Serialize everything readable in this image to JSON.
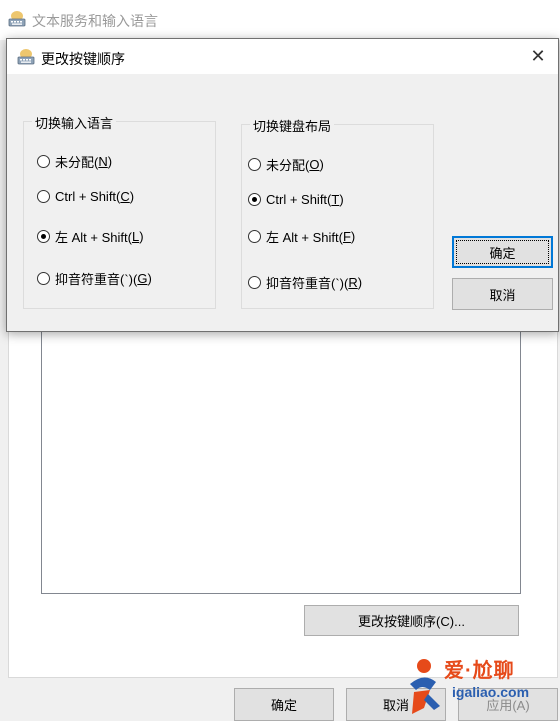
{
  "parent_window": {
    "title": "文本服务和输入语言",
    "change_key_sequence_button": "更改按键顺序(C)...",
    "ok_label": "确定",
    "cancel_label": "取消",
    "apply_label": "应用(A)"
  },
  "dialog": {
    "title": "更改按键顺序",
    "close_label": "✕",
    "input_language_group": {
      "legend": "切换输入语言",
      "options": [
        {
          "pre": "未分配(",
          "key": "N",
          "post": ")",
          "checked": false
        },
        {
          "pre": "Ctrl + Shift(",
          "key": "C",
          "post": ")",
          "checked": false
        },
        {
          "pre": "左 Alt + Shift(",
          "key": "L",
          "post": ")",
          "checked": true
        },
        {
          "pre": "抑音符重音(`)(",
          "key": "G",
          "post": ")",
          "checked": false
        }
      ]
    },
    "keyboard_layout_group": {
      "legend": "切换键盘布局",
      "options": [
        {
          "pre": "未分配(",
          "key": "O",
          "post": ")",
          "checked": false
        },
        {
          "pre": "Ctrl + Shift(",
          "key": "T",
          "post": ")",
          "checked": true
        },
        {
          "pre": "左 Alt + Shift(",
          "key": "F",
          "post": ")",
          "checked": false
        },
        {
          "pre": "抑音符重音(`)(",
          "key": "R",
          "post": ")",
          "checked": false
        }
      ]
    },
    "ok_label": "确定",
    "cancel_label": "取消"
  },
  "watermark": {
    "brand": "爱·尬聊",
    "url": "igaliao.com"
  },
  "colors": {
    "accent": "#0078d7",
    "watermark_red": "#e64a1a",
    "watermark_blue": "#2b5fb0"
  }
}
